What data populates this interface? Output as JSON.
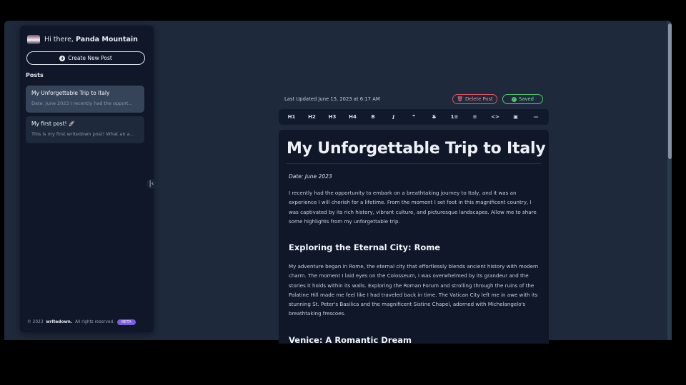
{
  "sidebar": {
    "greeting_prefix": "Hi there,",
    "user_name": "Panda Mountain",
    "create_label": "Create New Post",
    "posts_heading": "Posts",
    "posts": [
      {
        "title": "My Unforgettable Trip to Italy",
        "excerpt": "Date: June 2023 I recently had the opport...",
        "active": true
      },
      {
        "title": "My first post! 🚀",
        "excerpt": "This is my first writedown post! What an a...",
        "active": false
      }
    ],
    "footer": {
      "copyright": "© 2023",
      "brand": "writedown.",
      "rights": "All rights reserved.",
      "badge": "BETA"
    },
    "collapse_icon": "collapse-left-icon"
  },
  "editor_header": {
    "last_updated": "Last Updated June 15, 2023 at 6:17 AM",
    "delete_label": "Delete Post",
    "saved_label": "Saved"
  },
  "toolbar": {
    "buttons": [
      "H1",
      "H2",
      "H3",
      "H4",
      "B",
      "I",
      "❞",
      "S",
      "1≡",
      "≡",
      "<>",
      "▣",
      "—"
    ]
  },
  "document": {
    "title": "My Unforgettable Trip to Italy",
    "date": "Date: June 2023",
    "intro": "I recently had the opportunity to embark on a breathtaking journey to Italy, and it was an experience I will cherish for a lifetime. From the moment I set foot in this magnificent country, I was captivated by its rich history, vibrant culture, and picturesque landscapes. Allow me to share some highlights from my unforgettable trip.",
    "section1_heading": "Exploring the Eternal City: Rome",
    "section1_body": "My adventure began in Rome, the eternal city that effortlessly blends ancient history with modern charm. The moment I laid eyes on the Colosseum, I was overwhelmed by its grandeur and the stories it holds within its walls. Exploring the Roman Forum and strolling through the ruins of the Palatine Hill made me feel like I had traveled back in time. The Vatican City left me in awe with its stunning St. Peter's Basilica and the magnificent Sistine Chapel, adorned with Michelangelo's breathtaking frescoes.",
    "section2_heading": "Venice: A Romantic Dream"
  },
  "colors": {
    "accent": "#7c5ce0",
    "danger": "#e05561",
    "success": "#4fc56d",
    "panel": "#0f1728",
    "background": "#1e293b"
  }
}
